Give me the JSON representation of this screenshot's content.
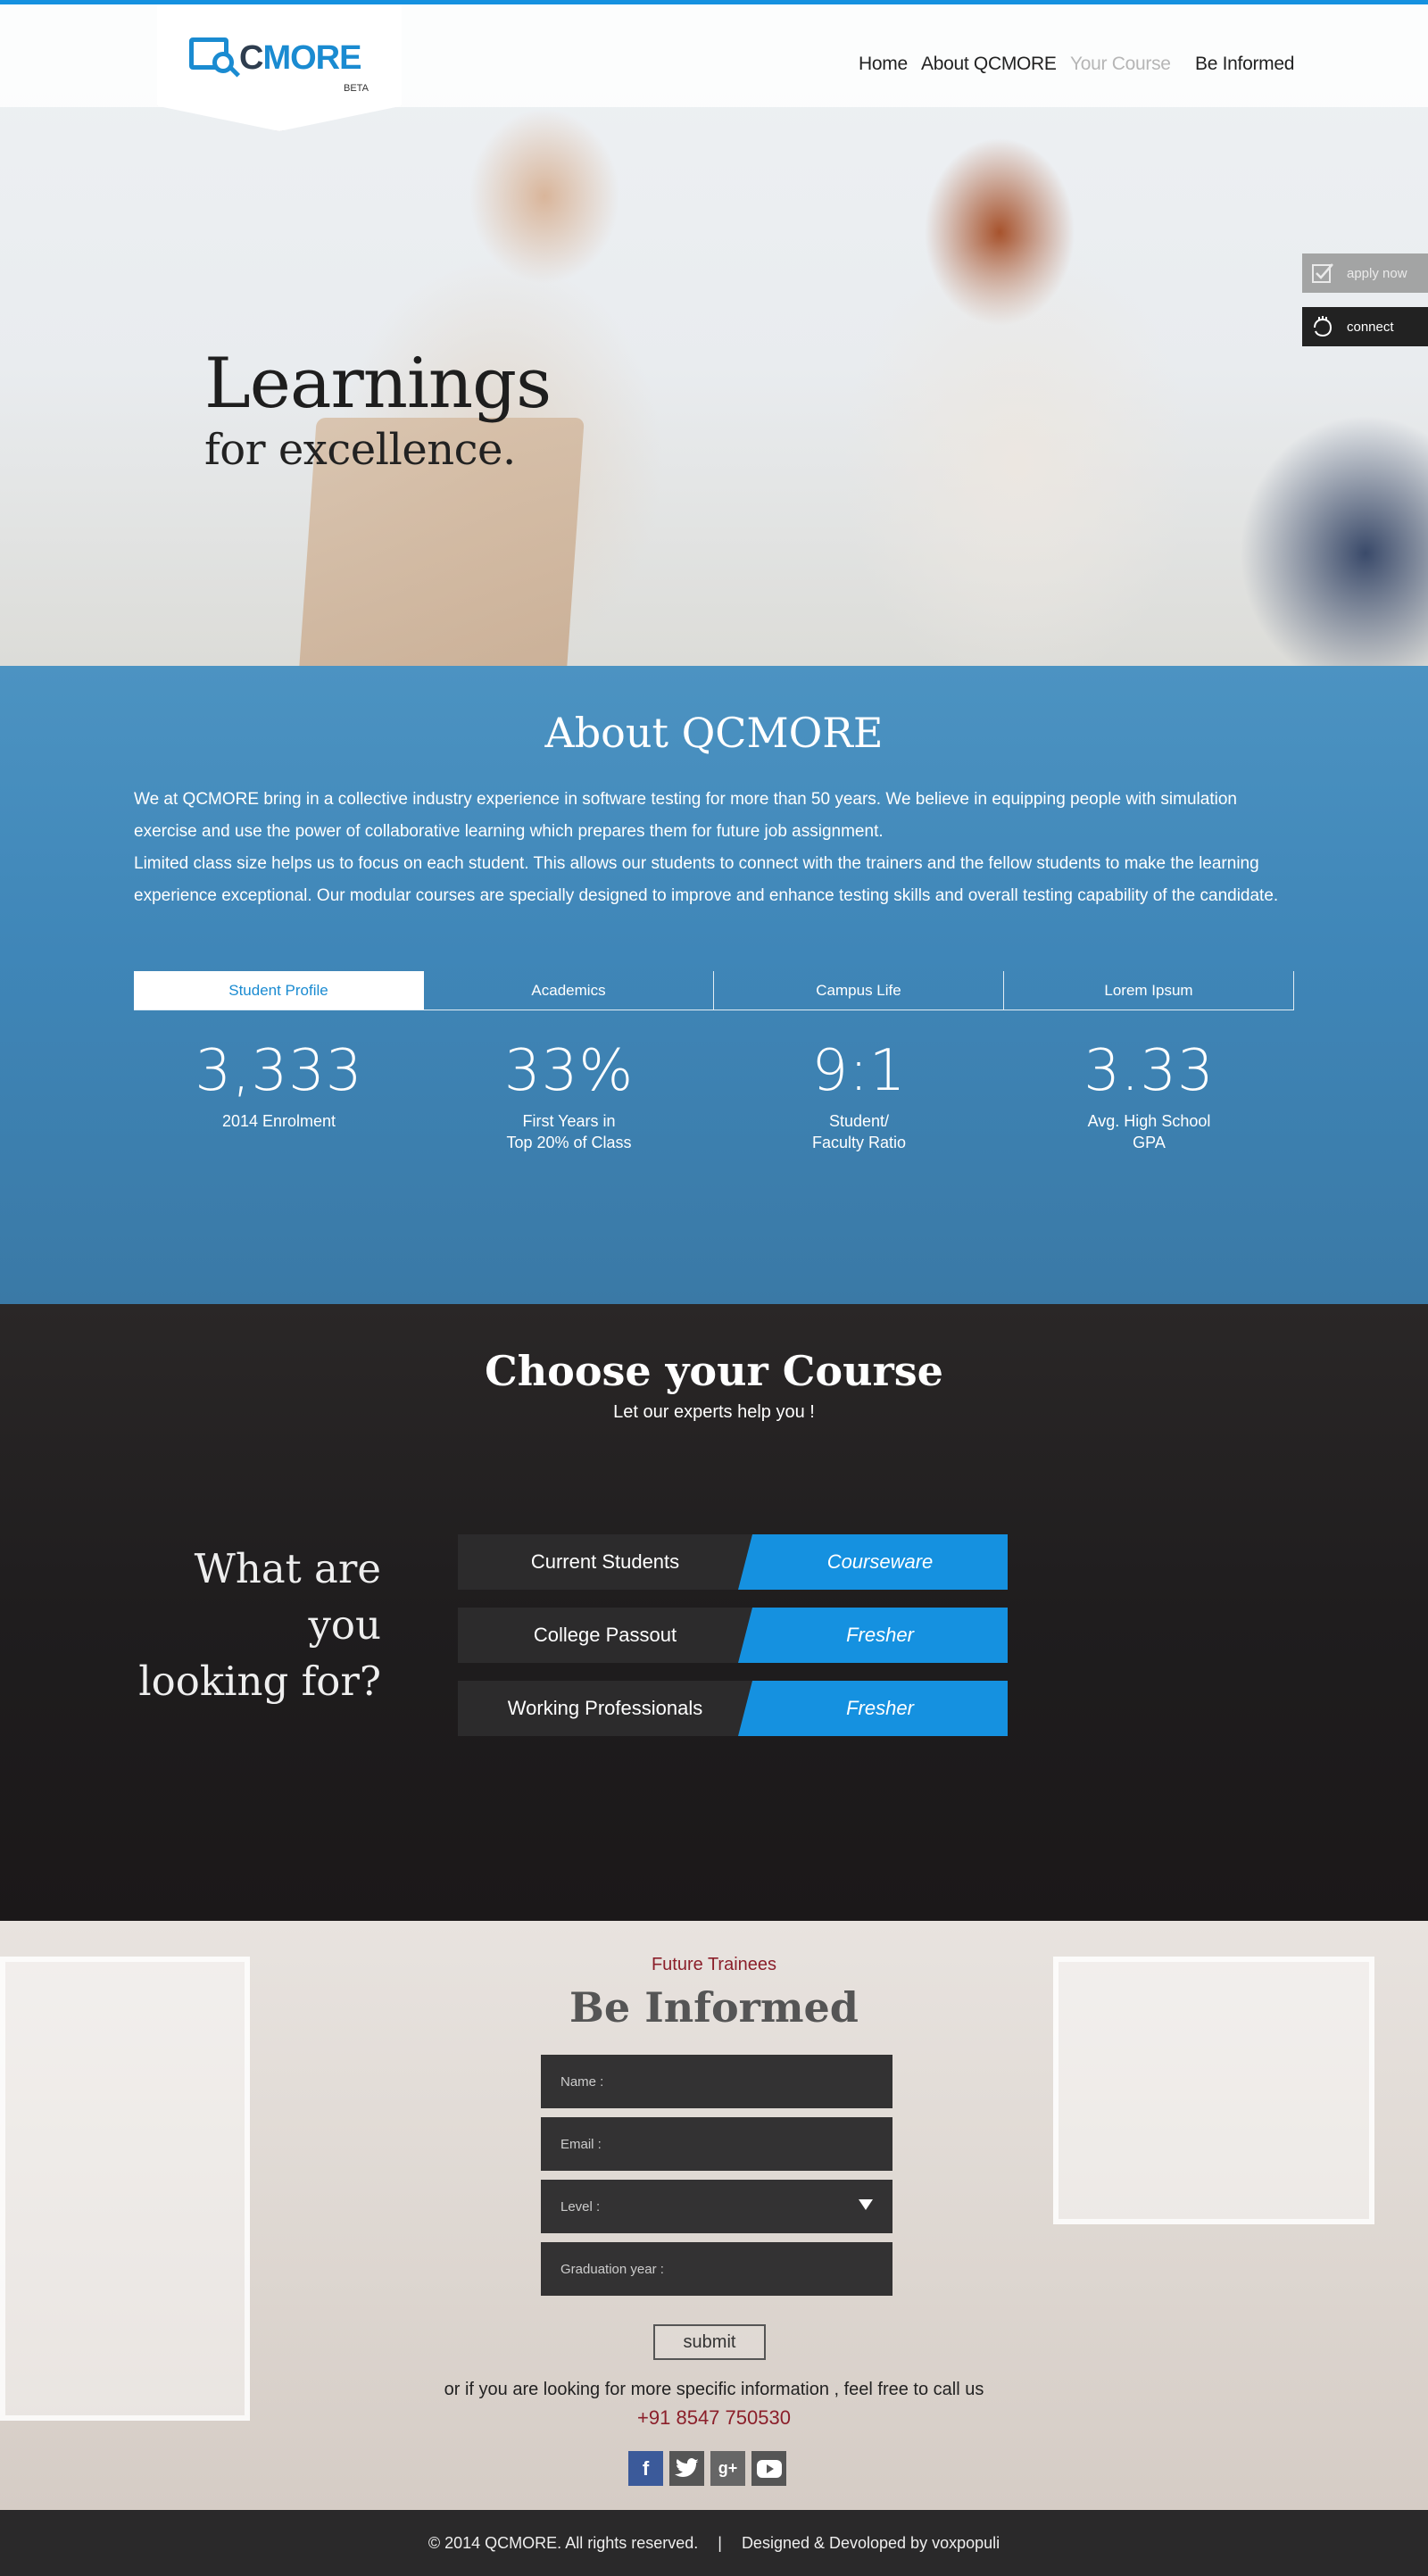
{
  "header": {
    "logo_text_left": "Q",
    "logo_text_mid": "C",
    "logo_text_right": "MORE",
    "logo_beta": "BETA",
    "nav": [
      {
        "label": "Home"
      },
      {
        "label": "About QCMORE"
      },
      {
        "label": "Your Course"
      },
      {
        "label": "Be Informed"
      }
    ]
  },
  "side_buttons": {
    "apply": {
      "label": "apply now",
      "icon": "checkbox-icon"
    },
    "connect": {
      "label": "connect",
      "icon": "hand-icon"
    }
  },
  "hero": {
    "title": "Learnings",
    "subtitle": "for excellence."
  },
  "about": {
    "title": "About QCMORE",
    "paragraph1": "We at QCMORE bring in a collective industry experience in software testing for more than 50 years. We believe in equipping people with simulation exercise and use the power of collaborative learning which prepares them for future job assignment.",
    "paragraph2": "Limited class size helps us to focus on each student.  This allows our students to connect with the trainers and the fellow students to make the learning experience exceptional. Our modular courses are specially designed to improve and enhance testing skills and overall testing capability of the candidate.",
    "tabs": [
      {
        "label": "Student Profile"
      },
      {
        "label": "Academics"
      },
      {
        "label": "Campus Life"
      },
      {
        "label": "Lorem Ipsum"
      }
    ],
    "stats": [
      {
        "value": "3,333",
        "label": "2014 Enrolment"
      },
      {
        "value": "33%",
        "label": "First Years in\nTop 20% of Class"
      },
      {
        "value": "9:1",
        "label": "Student/\nFaculty Ratio"
      },
      {
        "value": "3.33",
        "label": "Avg. High School\nGPA"
      }
    ]
  },
  "course": {
    "title": "Choose your Course",
    "subtitle": "Let our experts help you !",
    "question": "What are\nyou\nlooking for?",
    "options": [
      {
        "who": "Current Students",
        "what": "Courseware"
      },
      {
        "who": "College Passout",
        "what": "Fresher"
      },
      {
        "who": "Working Professionals",
        "what": "Fresher"
      }
    ]
  },
  "inform": {
    "kicker": "Future Trainees",
    "title": "Be Informed",
    "fields": {
      "name": "Name :",
      "email": "Email :",
      "level": "Level :",
      "graduation": "Graduation year :"
    },
    "submit": "submit",
    "call_text": "or if you are looking for more specific information , feel free to call us",
    "phone": "+91 8547 750530",
    "socials": [
      {
        "name": "facebook-icon",
        "glyph": "f"
      },
      {
        "name": "twitter-icon",
        "glyph": "t"
      },
      {
        "name": "google-plus-icon",
        "glyph": "g+"
      },
      {
        "name": "youtube-icon",
        "glyph": "▶"
      }
    ]
  },
  "footer": {
    "copyright": "© 2014 QCMORE. All rights reserved.",
    "separator": "|",
    "credit": "Designed & Devoloped by voxpopuli"
  },
  "colors": {
    "accent": "#1591e0",
    "brand_dark": "#2e3d4f",
    "phone": "#8b1f2a"
  }
}
